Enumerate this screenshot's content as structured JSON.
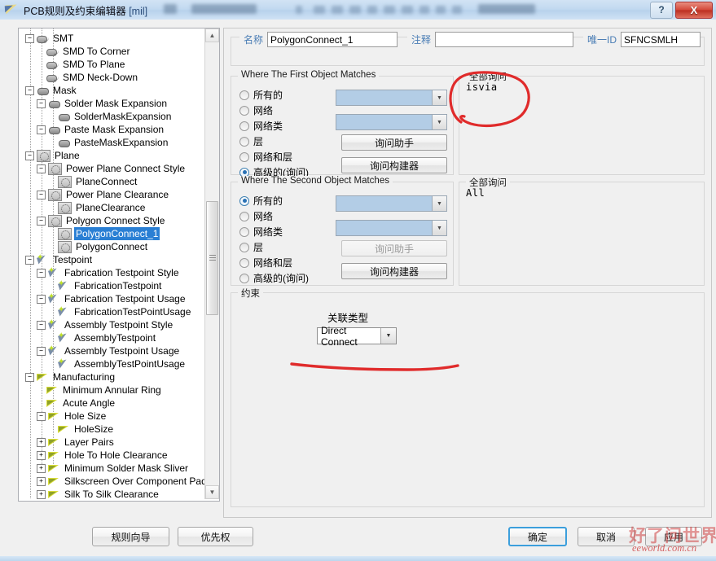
{
  "window": {
    "title": "PCB规则及约束编辑器",
    "title_unit": "[mil]",
    "help_label": "?",
    "close_label": "X"
  },
  "tree": {
    "items": [
      {
        "label": "SMT",
        "depth": 0,
        "icon": "smt-icon",
        "expander": "minus",
        "selected": false
      },
      {
        "label": "SMD To Corner",
        "depth": 1,
        "icon": "smt-icon",
        "expander": "none",
        "selected": false
      },
      {
        "label": "SMD To Plane",
        "depth": 1,
        "icon": "smt-icon",
        "expander": "none",
        "selected": false
      },
      {
        "label": "SMD Neck-Down",
        "depth": 1,
        "icon": "smt-icon",
        "expander": "none",
        "selected": false
      },
      {
        "label": "Mask",
        "depth": 0,
        "icon": "mask-icon",
        "expander": "minus",
        "selected": false
      },
      {
        "label": "Solder Mask Expansion",
        "depth": 1,
        "icon": "mask-icon",
        "expander": "minus",
        "selected": false
      },
      {
        "label": "SolderMaskExpansion",
        "depth": 2,
        "icon": "mask-icon",
        "expander": "none",
        "selected": false
      },
      {
        "label": "Paste Mask Expansion",
        "depth": 1,
        "icon": "mask-icon",
        "expander": "minus",
        "selected": false
      },
      {
        "label": "PasteMaskExpansion",
        "depth": 2,
        "icon": "mask-icon",
        "expander": "none",
        "selected": false
      },
      {
        "label": "Plane",
        "depth": 0,
        "icon": "plane-icon",
        "expander": "minus",
        "selected": false
      },
      {
        "label": "Power Plane Connect Style",
        "depth": 1,
        "icon": "plane-icon",
        "expander": "minus",
        "selected": false
      },
      {
        "label": "PlaneConnect",
        "depth": 2,
        "icon": "plane-icon",
        "expander": "none",
        "selected": false
      },
      {
        "label": "Power Plane Clearance",
        "depth": 1,
        "icon": "plane-icon",
        "expander": "minus",
        "selected": false
      },
      {
        "label": "PlaneClearance",
        "depth": 2,
        "icon": "plane-icon",
        "expander": "none",
        "selected": false
      },
      {
        "label": "Polygon Connect Style",
        "depth": 1,
        "icon": "plane-icon",
        "expander": "minus",
        "selected": false
      },
      {
        "label": "PolygonConnect_1",
        "depth": 2,
        "icon": "plane-icon",
        "expander": "none",
        "selected": true
      },
      {
        "label": "PolygonConnect",
        "depth": 2,
        "icon": "plane-icon",
        "expander": "none",
        "selected": false
      },
      {
        "label": "Testpoint",
        "depth": 0,
        "icon": "testpoint-icon",
        "expander": "minus",
        "selected": false
      },
      {
        "label": "Fabrication Testpoint Style",
        "depth": 1,
        "icon": "testpoint-icon",
        "expander": "minus",
        "selected": false
      },
      {
        "label": "FabricationTestpoint",
        "depth": 2,
        "icon": "testpoint-icon",
        "expander": "none",
        "selected": false
      },
      {
        "label": "Fabrication Testpoint Usage",
        "depth": 1,
        "icon": "testpoint-icon",
        "expander": "minus",
        "selected": false
      },
      {
        "label": "FabricationTestPointUsage",
        "depth": 2,
        "icon": "testpoint-icon",
        "expander": "none",
        "selected": false
      },
      {
        "label": "Assembly Testpoint Style",
        "depth": 1,
        "icon": "testpoint-icon",
        "expander": "minus",
        "selected": false
      },
      {
        "label": "AssemblyTestpoint",
        "depth": 2,
        "icon": "testpoint-icon",
        "expander": "none",
        "selected": false
      },
      {
        "label": "Assembly Testpoint Usage",
        "depth": 1,
        "icon": "testpoint-icon",
        "expander": "minus",
        "selected": false
      },
      {
        "label": "AssemblyTestPointUsage",
        "depth": 2,
        "icon": "testpoint-icon",
        "expander": "none",
        "selected": false
      },
      {
        "label": "Manufacturing",
        "depth": 0,
        "icon": "manufacturing-icon",
        "expander": "minus",
        "selected": false
      },
      {
        "label": "Minimum Annular Ring",
        "depth": 1,
        "icon": "manufacturing-icon",
        "expander": "none",
        "selected": false
      },
      {
        "label": "Acute Angle",
        "depth": 1,
        "icon": "manufacturing-icon",
        "expander": "none",
        "selected": false
      },
      {
        "label": "Hole Size",
        "depth": 1,
        "icon": "manufacturing-icon",
        "expander": "minus",
        "selected": false
      },
      {
        "label": "HoleSize",
        "depth": 2,
        "icon": "manufacturing-icon",
        "expander": "none",
        "selected": false
      },
      {
        "label": "Layer Pairs",
        "depth": 1,
        "icon": "manufacturing-icon",
        "expander": "plus",
        "selected": false
      },
      {
        "label": "Hole To Hole Clearance",
        "depth": 1,
        "icon": "manufacturing-icon",
        "expander": "plus",
        "selected": false
      },
      {
        "label": "Minimum Solder Mask Sliver",
        "depth": 1,
        "icon": "manufacturing-icon",
        "expander": "plus",
        "selected": false
      },
      {
        "label": "Silkscreen Over Component Pads",
        "depth": 1,
        "icon": "manufacturing-icon",
        "expander": "plus",
        "selected": false
      },
      {
        "label": "Silk To Silk Clearance",
        "depth": 1,
        "icon": "manufacturing-icon",
        "expander": "plus",
        "selected": false
      }
    ],
    "scroll_up_arrow": "▲",
    "scroll_down_arrow": "▼"
  },
  "header": {
    "name_label": "名称",
    "name_value": "PolygonConnect_1",
    "comment_label": "注释",
    "comment_value": "",
    "uid_label": "唯一ID",
    "uid_value": "SFNCSMLH"
  },
  "first_object": {
    "legend": "Where The First Object Matches",
    "options": [
      {
        "label": "所有的",
        "selected": false
      },
      {
        "label": "网络",
        "selected": false
      },
      {
        "label": "网络类",
        "selected": false
      },
      {
        "label": "层",
        "selected": false
      },
      {
        "label": "网络和层",
        "selected": false
      },
      {
        "label": "高级的(询问)",
        "selected": true
      }
    ],
    "combo1_value": "",
    "combo2_value": "",
    "helper_button": "询问助手",
    "builder_button": "询问构建器",
    "helper_disabled": false
  },
  "second_object": {
    "legend": "Where The Second Object Matches",
    "options": [
      {
        "label": "所有的",
        "selected": true
      },
      {
        "label": "网络",
        "selected": false
      },
      {
        "label": "网络类",
        "selected": false
      },
      {
        "label": "层",
        "selected": false
      },
      {
        "label": "网络和层",
        "selected": false
      },
      {
        "label": "高级的(询问)",
        "selected": false
      }
    ],
    "combo1_value": "",
    "combo2_value": "",
    "helper_button": "询问助手",
    "builder_button": "询问构建器",
    "helper_disabled": true
  },
  "query_first": {
    "legend": "全部询问",
    "text": "isvia"
  },
  "query_second": {
    "legend": "全部询问",
    "text": "All"
  },
  "constraints": {
    "legend": "约束",
    "connect_type_label": "关联类型",
    "connect_type_value": "Direct Connect",
    "dropdown_arrow": "▼"
  },
  "footer": {
    "rule_wizard": "规则向导",
    "priority": "优先权",
    "ok": "确定",
    "cancel": "取消",
    "apply": "应用"
  },
  "watermark": {
    "text": "好了问世界",
    "url": "eeworld.com.cn"
  },
  "colors": {
    "selection": "#2a7fd4",
    "annotation": "#e02b2b",
    "combo_fill": "#b3cde6",
    "label_blue": "#4a7db5",
    "primary_border": "#3c9fdc"
  }
}
